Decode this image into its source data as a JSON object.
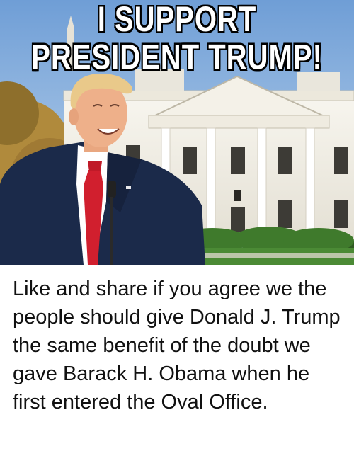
{
  "headline": {
    "line1": "I SUPPORT",
    "line2": "PRESIDENT TRUMP!"
  },
  "caption": "Like and share if you agree we the people should give Donald J. Trump the same benefit of the doubt we gave Barack H. Obama when he first entered the Oval Office.",
  "colors": {
    "sky": "#8fb6e0",
    "building": "#f2efe6",
    "suit": "#1b2a4a",
    "tie": "#d11f2e",
    "lawn": "#3f7a2c"
  }
}
